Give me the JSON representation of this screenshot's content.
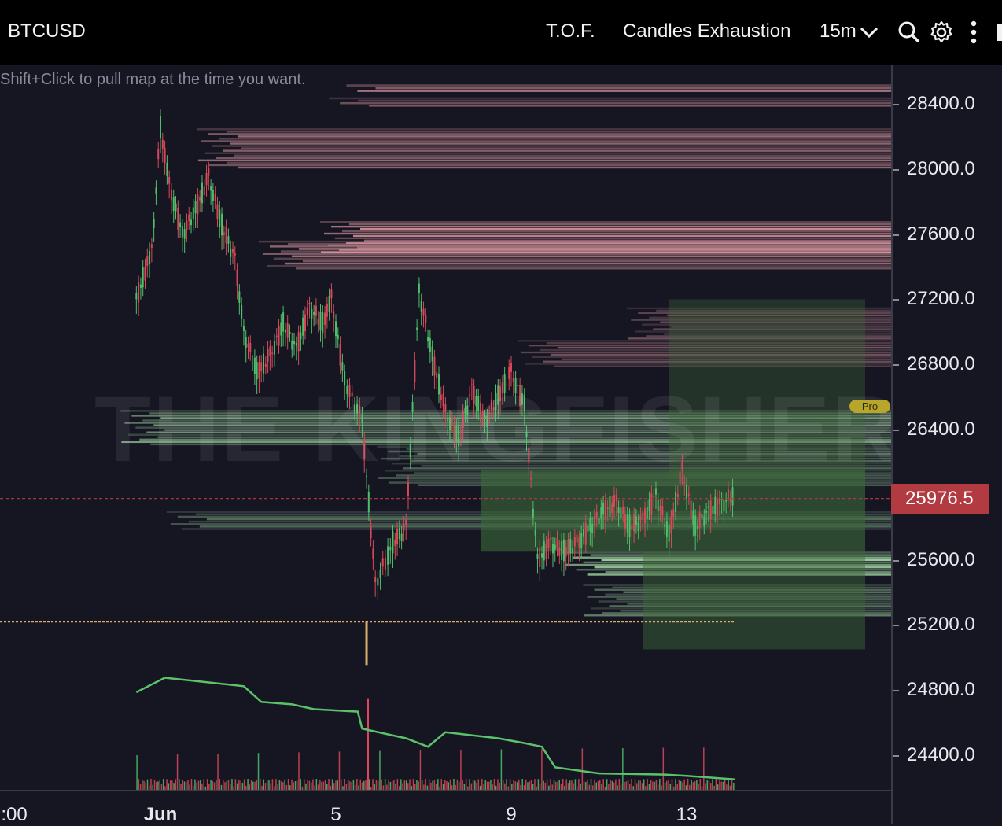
{
  "header": {
    "symbol": "BTCUSD",
    "indicator1": "T.O.F.",
    "indicator2": "Candles Exhaustion",
    "timeframe": "15m"
  },
  "icons": {
    "timeframe_dropdown": "chevron-down-icon",
    "search": "search-icon",
    "settings": "gear-icon",
    "more": "more-vertical-icon"
  },
  "hint_text": "Shift+Click to pull map at the time you want.",
  "watermark": "THE KINGFISHER.io",
  "pro_badge": "Pro",
  "colors": {
    "background": "#161623",
    "topbar": "#000000",
    "ask_liquidity": "#e8a0a8",
    "bid_liquidity": "#a8e0a8",
    "candle_up": "#4fbf6a",
    "candle_down": "#d9485a",
    "current_price": "#b23b42",
    "volume_line": "#5cc26a"
  },
  "chart_data": {
    "type": "line",
    "title": "",
    "xlabel": "",
    "ylabel": "",
    "ylim": [
      24300,
      28600
    ],
    "price_ticks": [
      "28400.0",
      "28000.0",
      "27600.0",
      "27200.0",
      "26800.0",
      "26400.0",
      "25200.0",
      "24800.0",
      "24400.0",
      "25600.0"
    ],
    "price_tick_values": [
      28400,
      28000,
      27600,
      27200,
      26800,
      26400,
      25200,
      24800,
      24400,
      25600
    ],
    "current_price": 25976.5,
    "current_price_label": "25976.5",
    "time_ticks": [
      {
        "label": ":00",
        "bold": false,
        "day": 0.5
      },
      {
        "label": "Jun",
        "bold": true,
        "day": 1
      },
      {
        "label": "5",
        "bold": false,
        "day": 5
      },
      {
        "label": "9",
        "bold": false,
        "day": 9
      },
      {
        "label": "13",
        "bold": false,
        "day": 13
      }
    ],
    "x_range_days": [
      0.45,
      20.7
    ],
    "series": [
      {
        "values_day": [
          0.45,
          0.8,
          1.0,
          1.2,
          1.5,
          1.8,
          2.1,
          2.4,
          2.7,
          2.9,
          3.2,
          3.5,
          3.8,
          4.1,
          4.4,
          4.7,
          4.9,
          5.2,
          5.6,
          5.9,
          6.3,
          6.6,
          6.9,
          7.2,
          7.5,
          7.8,
          8.1,
          8.4,
          8.7,
          9.0,
          9.3,
          9.6,
          9.9,
          10.2,
          10.5,
          10.8,
          11.1,
          11.4,
          11.7,
          12.0,
          12.3,
          12.6,
          12.9,
          13.2,
          13.5,
          13.8,
          14.1
        ],
        "values_price": [
          27200,
          27500,
          28250,
          27900,
          27600,
          27750,
          27950,
          27650,
          27450,
          27000,
          26750,
          26850,
          27050,
          26900,
          27150,
          27050,
          27200,
          26700,
          26450,
          25450,
          25700,
          25800,
          27250,
          26850,
          26500,
          26350,
          26650,
          26450,
          26600,
          26750,
          26550,
          25600,
          25700,
          25650,
          25700,
          25800,
          25900,
          25950,
          25800,
          25850,
          26000,
          25750,
          26150,
          25800,
          25900,
          25950,
          26000
        ]
      }
    ],
    "volume_line": {
      "values_day": [
        0.45,
        1.1,
        2.9,
        3.3,
        4.0,
        4.5,
        5.5,
        5.6,
        6.6,
        7.1,
        7.5,
        8.7,
        9.3,
        9.7,
        10.0,
        11.0,
        12.5,
        13.0,
        14.1
      ],
      "values_rel": [
        0.78,
        0.9,
        0.83,
        0.7,
        0.68,
        0.64,
        0.62,
        0.48,
        0.4,
        0.33,
        0.45,
        0.4,
        0.36,
        0.33,
        0.16,
        0.11,
        0.1,
        0.09,
        0.06
      ]
    },
    "liquidity_bands": [
      {
        "side": "ask",
        "from_price": 28520,
        "to_price": 28470,
        "start_day": 5.6,
        "intensity": 0.9
      },
      {
        "side": "ask",
        "from_price": 28440,
        "to_price": 28380,
        "start_day": 5.2,
        "intensity": 0.55
      },
      {
        "side": "ask",
        "from_price": 28250,
        "to_price": 28000,
        "start_day": 2.2,
        "intensity": 0.65
      },
      {
        "side": "ask",
        "from_price": 27680,
        "to_price": 27480,
        "start_day": 5.0,
        "intensity": 0.9
      },
      {
        "side": "ask",
        "from_price": 27560,
        "to_price": 27380,
        "start_day": 3.6,
        "intensity": 0.75
      },
      {
        "side": "ask",
        "from_price": 27150,
        "to_price": 26950,
        "start_day": 12.0,
        "intensity": 0.45
      },
      {
        "side": "ask",
        "from_price": 26950,
        "to_price": 26780,
        "start_day": 9.5,
        "intensity": 0.5
      },
      {
        "side": "bid",
        "from_price": 26520,
        "to_price": 26300,
        "start_day": 0.45,
        "intensity": 0.7
      },
      {
        "side": "bid",
        "from_price": 26300,
        "to_price": 26050,
        "start_day": 6.3,
        "intensity": 0.45
      },
      {
        "side": "bid",
        "from_price": 25900,
        "to_price": 25780,
        "start_day": 1.5,
        "intensity": 0.45
      },
      {
        "side": "bid",
        "from_price": 25650,
        "to_price": 25500,
        "start_day": 10.5,
        "intensity": 0.95
      },
      {
        "side": "bid",
        "from_price": 25450,
        "to_price": 25250,
        "start_day": 11.0,
        "intensity": 0.55
      }
    ],
    "grid": false,
    "legend": "none"
  }
}
